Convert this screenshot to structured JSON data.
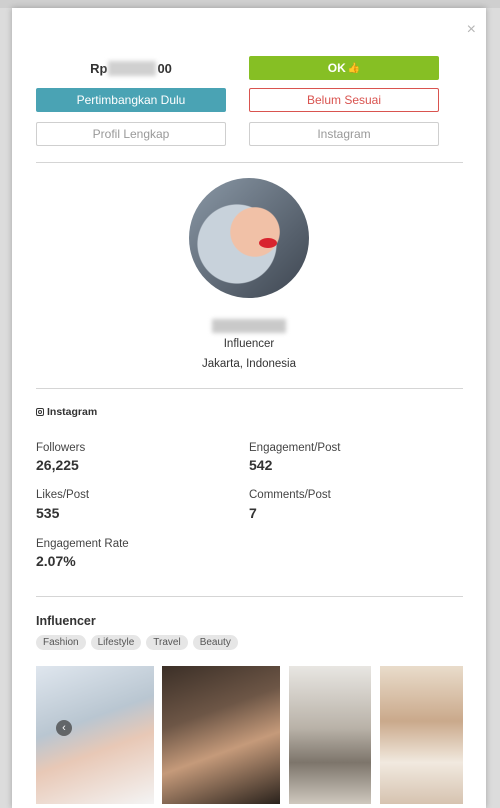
{
  "modal": {
    "close_icon": "×",
    "price_prefix": "Rp",
    "price_suffix": "00",
    "ok_label": "OK",
    "thumb_icon": "👍",
    "consider_label": "Pertimbangkan Dulu",
    "not_yet_label": "Belum Sesuai",
    "full_profile_label": "Profil Lengkap",
    "instagram_button_label": "Instagram"
  },
  "profile": {
    "role": "Influencer",
    "location": "Jakarta, Indonesia"
  },
  "instagram": {
    "section_label": "Instagram",
    "stats": {
      "followers_label": "Followers",
      "followers_value": "26,225",
      "engagement_post_label": "Engagement/Post",
      "engagement_post_value": "542",
      "likes_post_label": "Likes/Post",
      "likes_post_value": "535",
      "comments_post_label": "Comments/Post",
      "comments_post_value": "7",
      "engagement_rate_label": "Engagement Rate",
      "engagement_rate_value": "2.07%"
    }
  },
  "influencer": {
    "title": "Influencer",
    "tags": [
      "Fashion",
      "Lifestyle",
      "Travel",
      "Beauty"
    ],
    "carousel_prev_icon": "‹"
  },
  "colors": {
    "ok": "#86bf24",
    "consider": "#4aa3b4",
    "not_yet": "#d9534f"
  }
}
